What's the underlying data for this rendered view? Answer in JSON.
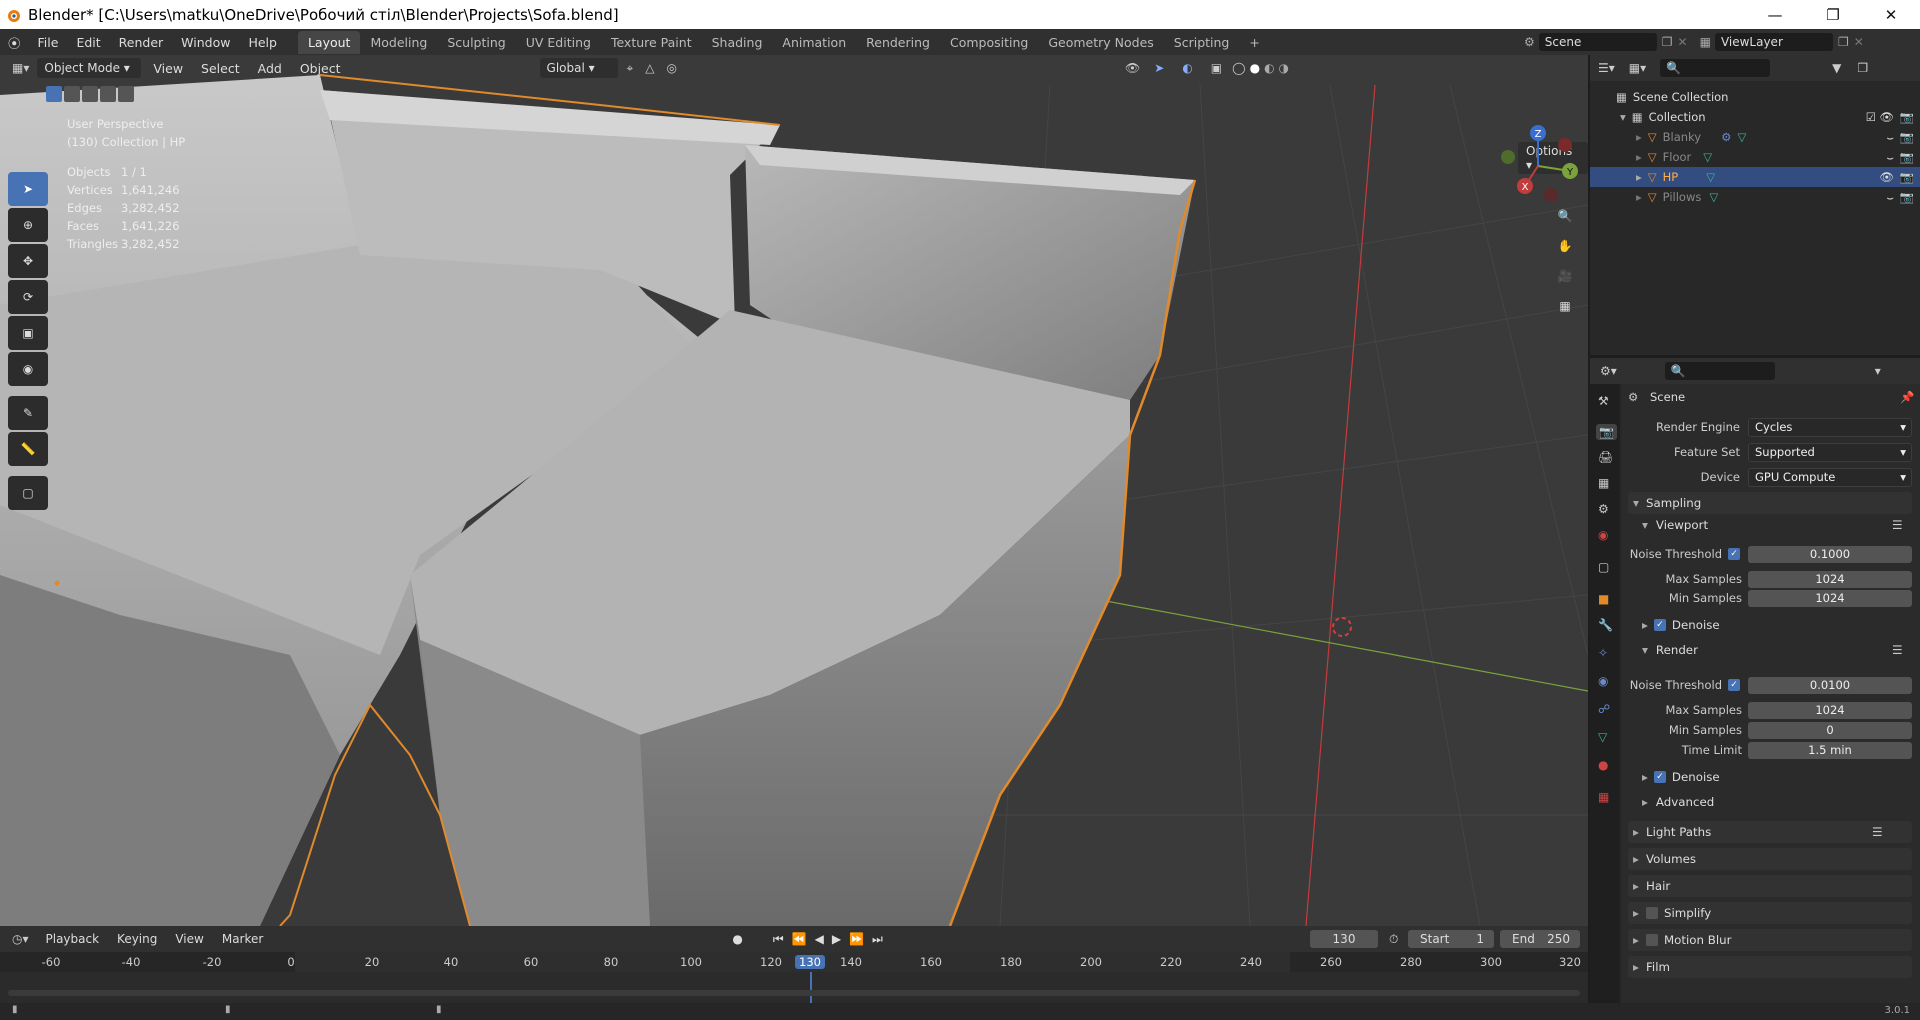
{
  "window": {
    "title": "Blender* [C:\\Users\\matku\\OneDrive\\Робочий стіл\\Blender\\Projects\\Sofa.blend]"
  },
  "menu": [
    "File",
    "Edit",
    "Render",
    "Window",
    "Help"
  ],
  "workspaces": [
    "Layout",
    "Modeling",
    "Sculpting",
    "UV Editing",
    "Texture Paint",
    "Shading",
    "Animation",
    "Rendering",
    "Compositing",
    "Geometry Nodes",
    "Scripting"
  ],
  "active_workspace": "Layout",
  "scene_name": "Scene",
  "view_layer": "ViewLayer",
  "viewport": {
    "mode": "Object Mode",
    "menus": [
      "View",
      "Select",
      "Add",
      "Object"
    ],
    "orientation": "Global",
    "options_label": "Options",
    "perspective": "User Perspective",
    "collection_info": "(130) Collection | HP",
    "stats": [
      {
        "label": "Objects",
        "value": "1 / 1"
      },
      {
        "label": "Vertices",
        "value": "1,641,246"
      },
      {
        "label": "Edges",
        "value": "3,282,452"
      },
      {
        "label": "Faces",
        "value": "1,641,226"
      },
      {
        "label": "Triangles",
        "value": "3,282,452"
      }
    ],
    "gizmo": {
      "x": "X",
      "y": "Y",
      "z": "Z"
    }
  },
  "outliner": {
    "scene_collection": "Scene Collection",
    "collection": "Collection",
    "objects": [
      "Blanky",
      "Floor",
      "HP",
      "Pillows"
    ],
    "selected": "HP"
  },
  "properties": {
    "context": "Scene",
    "render_engine_label": "Render Engine",
    "render_engine": "Cycles",
    "feature_set_label": "Feature Set",
    "feature_set": "Supported",
    "device_label": "Device",
    "device": "GPU Compute",
    "sampling": "Sampling",
    "viewport_label": "Viewport",
    "noise_threshold_label": "Noise Threshold",
    "viewport_noise_threshold": "0.1000",
    "max_samples_label": "Max Samples",
    "viewport_max_samples": "1024",
    "min_samples_label": "Min Samples",
    "viewport_min_samples": "1024",
    "denoise_label": "Denoise",
    "render_label": "Render",
    "render_noise_threshold": "0.0100",
    "render_max_samples": "1024",
    "render_min_samples": "0",
    "time_limit_label": "Time Limit",
    "time_limit": "1.5 min",
    "advanced_label": "Advanced",
    "sections": [
      "Light Paths",
      "Volumes",
      "Hair",
      "Simplify",
      "Motion Blur",
      "Film"
    ]
  },
  "timeline": {
    "menus": [
      "Playback",
      "Keying",
      "View",
      "Marker"
    ],
    "current_frame": "130",
    "start_label": "Start",
    "start": "1",
    "end_label": "End",
    "end": "250",
    "ruler": [
      "-60",
      "-40",
      "-20",
      "0",
      "20",
      "40",
      "60",
      "80",
      "100",
      "120",
      "130",
      "140",
      "160",
      "180",
      "200",
      "220",
      "240",
      "260",
      "280",
      "300",
      "320"
    ]
  },
  "version": "3.0.1",
  "colors": {
    "accent": "#4772b3",
    "selection_outline": "#e08a2c",
    "x_axis": "#c33c3c",
    "y_axis": "#7aa33c"
  }
}
